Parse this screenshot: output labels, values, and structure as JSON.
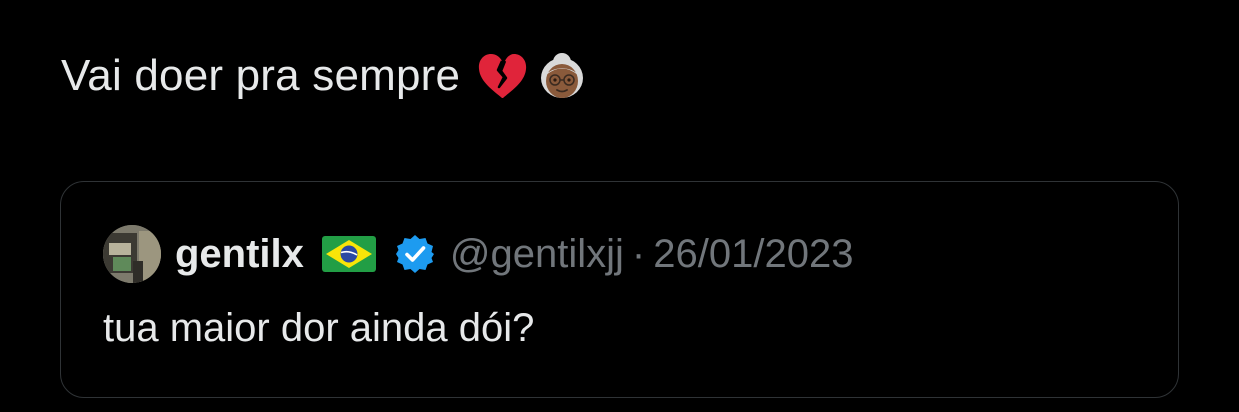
{
  "tweet": {
    "text": "Vai doer pra sempre",
    "emojis": [
      "broken-heart-icon",
      "old-woman-medium-dark-skin-icon"
    ]
  },
  "quote": {
    "display_name": "gentilx",
    "flag": "brazil-flag-icon",
    "verified": true,
    "handle": "@gentilxjj",
    "separator": "·",
    "date": "26/01/2023",
    "text": "tua maior dor ainda dói?"
  },
  "colors": {
    "background": "#000000",
    "primary_text": "#e7e9ea",
    "secondary_text": "#71767b",
    "border": "#2f3336",
    "verified_blue": "#1d9bf0",
    "broken_heart_red": "#e0243a"
  }
}
